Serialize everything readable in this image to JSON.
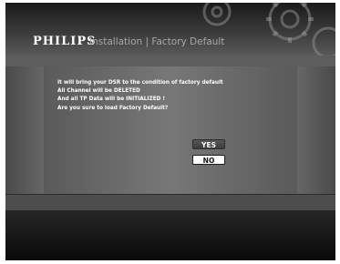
{
  "header": {
    "brand": "PHILIPS",
    "breadcrumb": "Installation | Factory Default"
  },
  "dialog": {
    "lines": [
      "It will bring your DSR to the condition of factory default",
      "All Channel will be DELETED",
      "And all TP Data will be INITIALIZED !",
      "Are you sure to load Factory Default?"
    ]
  },
  "buttons": {
    "yes_label": "YES",
    "no_label": "NO",
    "selected": "NO"
  },
  "icons": {
    "background_decoration": "gears-icon"
  }
}
